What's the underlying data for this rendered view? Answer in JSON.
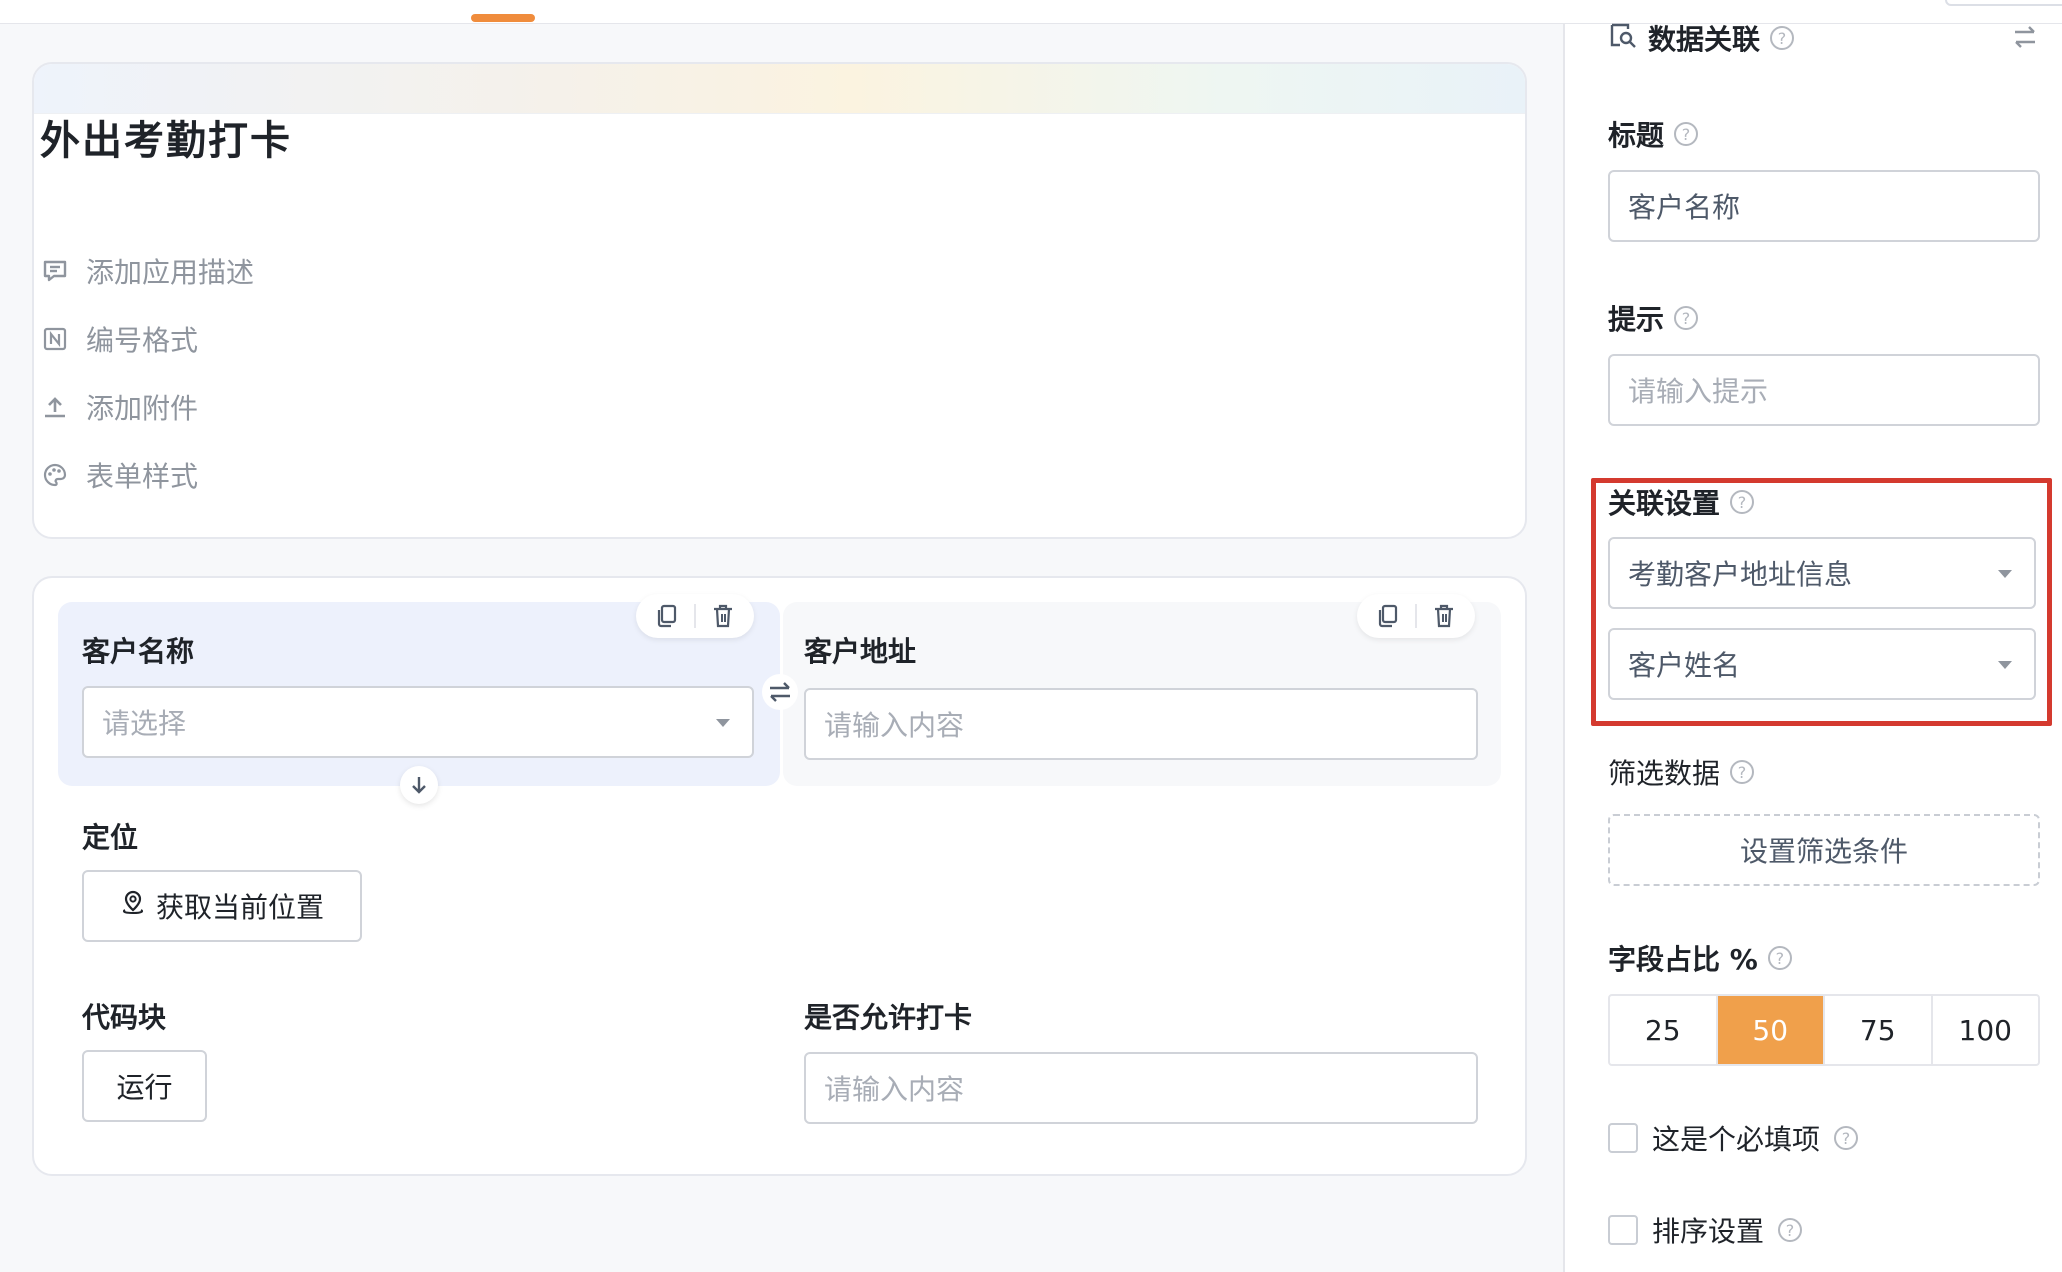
{
  "form": {
    "title": "外出考勤打卡",
    "actions": [
      {
        "label": "添加应用描述",
        "icon": "comment-icon"
      },
      {
        "label": "编号格式",
        "icon": "number-format-icon"
      },
      {
        "label": "添加附件",
        "icon": "upload-icon"
      },
      {
        "label": "表单样式",
        "icon": "palette-icon"
      }
    ]
  },
  "fields": {
    "customer_name": {
      "label": "客户名称",
      "placeholder": "请选择"
    },
    "customer_address": {
      "label": "客户地址",
      "placeholder": "请输入内容"
    },
    "location": {
      "label": "定位",
      "button": "获取当前位置"
    },
    "code_block": {
      "label": "代码块",
      "button": "运行"
    },
    "allow_checkin": {
      "label": "是否允许打卡",
      "placeholder": "请输入内容"
    }
  },
  "panel": {
    "header_title": "数据关联",
    "title_label": "标题",
    "title_value": "客户名称",
    "hint_label": "提示",
    "hint_placeholder": "请输入提示",
    "relation_label": "关联设置",
    "relation_source": "考勤客户地址信息",
    "relation_field": "客户姓名",
    "filter_label": "筛选数据",
    "filter_button": "设置筛选条件",
    "width_label": "字段占比 %",
    "width_options": [
      "25",
      "50",
      "75",
      "100"
    ],
    "width_selected": "50",
    "required_label": "这是个必填项",
    "sort_label": "排序设置"
  },
  "colors": {
    "accent": "#f0a04b",
    "highlight": "#d43a2f",
    "selected_field_bg": "#edf1fc"
  }
}
